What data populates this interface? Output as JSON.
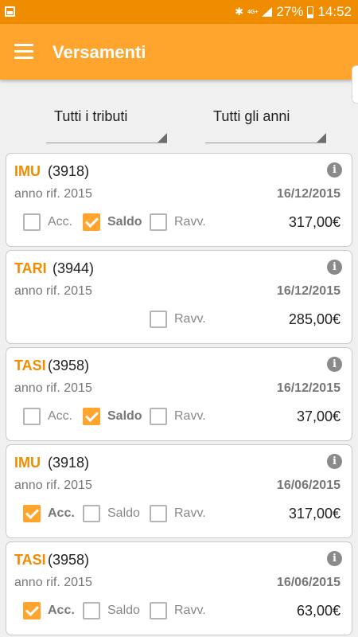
{
  "status_bar": {
    "network": "4G+",
    "battery": "27%",
    "time": "14:52"
  },
  "app_bar": {
    "title": "Versamenti"
  },
  "filters": {
    "tributi": "Tutti i tributi",
    "anni": "Tutti gli anni"
  },
  "labels": {
    "acc": "Acc.",
    "saldo": "Saldo",
    "ravv": "Ravv."
  },
  "payments": [
    {
      "name": "IMU",
      "code": "(3918)",
      "year": "anno rif. 2015",
      "date": "16/12/2015",
      "amount": "317,00€",
      "acc": false,
      "saldo": true,
      "ravv": false
    },
    {
      "name": "TARI",
      "code": "(3944)",
      "year": "anno rif. 2015",
      "date": "16/12/2015",
      "amount": "285,00€",
      "ravv": false
    },
    {
      "name": "TASI",
      "code": "(3958)",
      "year": "anno rif. 2015",
      "date": "16/12/2015",
      "amount": "37,00€",
      "acc": false,
      "saldo": true,
      "ravv": false
    },
    {
      "name": "IMU",
      "code": "(3918)",
      "year": "anno rif. 2015",
      "date": "16/06/2015",
      "amount": "317,00€",
      "acc": true,
      "saldo": false,
      "ravv": false
    },
    {
      "name": "TASI",
      "code": "(3958)",
      "year": "anno rif. 2015",
      "date": "16/06/2015",
      "amount": "63,00€",
      "acc": true,
      "saldo": false,
      "ravv": false
    }
  ],
  "colors": {
    "status_bar": "#f08c00",
    "app_bar": "#ffa42c",
    "accent": "#f08c00",
    "checkbox_checked": "#ffa42c"
  }
}
